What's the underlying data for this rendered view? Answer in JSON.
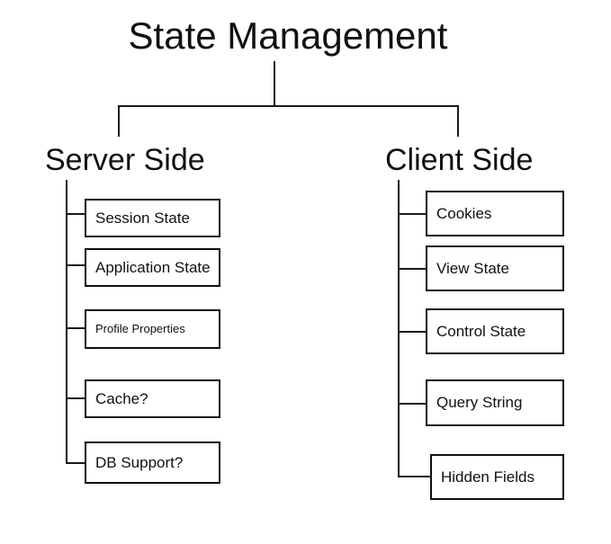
{
  "diagram": {
    "type": "tree-hierarchy",
    "title": "State Management",
    "background_color": "#ffffff",
    "line_color": "#1a1a1a",
    "text_color": "#111111",
    "branches": [
      {
        "label": "Server Side",
        "children": [
          {
            "label": "Session State"
          },
          {
            "label": "Application State"
          },
          {
            "label": "Profile Properties"
          },
          {
            "label": "Cache?"
          },
          {
            "label": "DB Support?"
          }
        ]
      },
      {
        "label": "Client Side",
        "children": [
          {
            "label": "Cookies"
          },
          {
            "label": "View State"
          },
          {
            "label": "Control State"
          },
          {
            "label": "Query String"
          },
          {
            "label": "Hidden Fields"
          }
        ]
      }
    ]
  }
}
